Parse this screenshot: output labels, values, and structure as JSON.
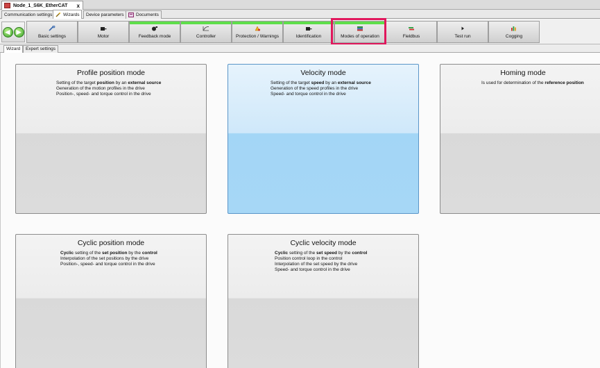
{
  "document_tab": {
    "label": "Node_1_S6K_EtherCAT",
    "close": "x"
  },
  "section_tabs": [
    {
      "label": "Communication settings"
    },
    {
      "label": "Wizards"
    },
    {
      "label": "Device parameters"
    },
    {
      "label": "Documents"
    }
  ],
  "wizard_steps": [
    {
      "label": "Basic settings",
      "icon": "wrench-icon"
    },
    {
      "label": "Motor",
      "icon": "motor-icon"
    },
    {
      "label": "Feedback mode",
      "icon": "encoder-icon"
    },
    {
      "label": "Controller",
      "icon": "curve-icon"
    },
    {
      "label": "Protection / Warnings",
      "icon": "warning-icon"
    },
    {
      "label": "Identification",
      "icon": "motor-id-icon"
    },
    {
      "label": "Modes of operation",
      "icon": "modes-icon"
    },
    {
      "label": "Fieldbus",
      "icon": "fieldbus-icon"
    },
    {
      "label": "Test run",
      "icon": "play-icon"
    },
    {
      "label": "Cogging",
      "icon": "bars-icon"
    }
  ],
  "sub_tabs": [
    {
      "label": "Wizard"
    },
    {
      "label": "Expert settings"
    }
  ],
  "modes": [
    {
      "title": "Profile position mode",
      "lines": [
        [
          "Setting of the target ",
          "position",
          " by an ",
          "external source",
          ""
        ],
        [
          "Generation of the motion profiles in the drive"
        ],
        [
          "Position-, speed- and torque control in the drive"
        ]
      ]
    },
    {
      "title": "Velocity mode",
      "lines": [
        [
          "Setting of the target ",
          "speed",
          " by an ",
          "external source",
          ""
        ],
        [
          "Generation of the speed profiles in the drive"
        ],
        [
          "Speed- and torque control in the drive"
        ]
      ]
    },
    {
      "title": "Homing mode",
      "lines": [
        [
          "Is used for determination of the ",
          "reference position",
          ""
        ]
      ]
    },
    {
      "title": "Cyclic position mode",
      "lines": [
        [
          "",
          "Cyclic",
          " setting of the ",
          "set position",
          " by the ",
          "control",
          ""
        ],
        [
          "Interpolation of the set positions by the drive"
        ],
        [
          "Position-, speed- and torque control in the drive"
        ]
      ]
    },
    {
      "title": "Cyclic velocity mode",
      "lines": [
        [
          "",
          "Cyclic",
          " setting of the ",
          "set speed",
          " by the ",
          "control",
          ""
        ],
        [
          "Position control loop in the control"
        ],
        [
          "Interpolation of the set speed by the drive"
        ],
        [
          "Speed- and torque control in the drive"
        ]
      ]
    }
  ],
  "selected_mode": "Velocity mode",
  "colors": {
    "highlight": "#e0175c",
    "step_done": "#5ede4a",
    "selected_card": "#a3d6f6"
  }
}
